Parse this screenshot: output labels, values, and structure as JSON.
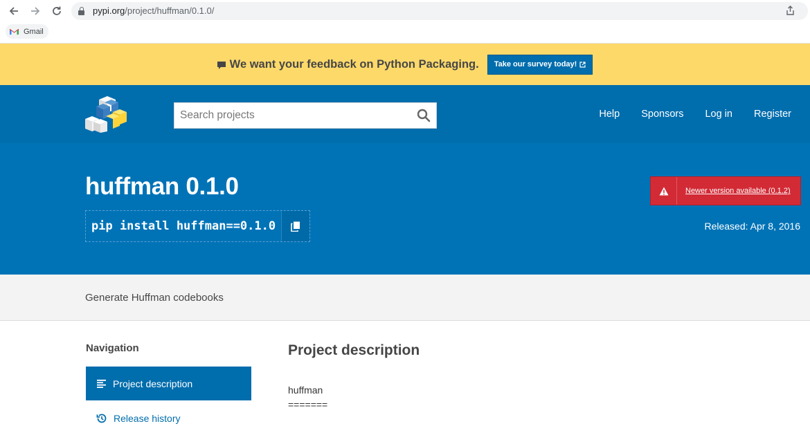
{
  "browser": {
    "url_host": "pypi.org",
    "url_path": "/project/huffman/0.1.0/",
    "bookmark_label": "Gmail"
  },
  "banner": {
    "message": "We want your feedback on Python Packaging.",
    "button_label": "Take our survey today!"
  },
  "header": {
    "search_placeholder": "Search projects",
    "nav": [
      "Help",
      "Sponsors",
      "Log in",
      "Register"
    ]
  },
  "project": {
    "title": "huffman 0.1.0",
    "pip_command": "pip install huffman==0.1.0",
    "newer_version_label": "Newer version available (0.1.2)",
    "released": "Released: Apr 8, 2016",
    "summary": "Generate Huffman codebooks"
  },
  "sidebar": {
    "heading": "Navigation",
    "items": [
      {
        "label": "Project description",
        "icon": "align-left-icon",
        "active": true
      },
      {
        "label": "Release history",
        "icon": "history-icon",
        "active": false
      }
    ]
  },
  "description": {
    "heading": "Project description",
    "lines": [
      "huffman",
      "======="
    ]
  },
  "colors": {
    "brand_blue": "#006dad",
    "hero_blue": "#0073b7",
    "banner_yellow": "#fdd96a",
    "danger_red": "#d22b36"
  }
}
